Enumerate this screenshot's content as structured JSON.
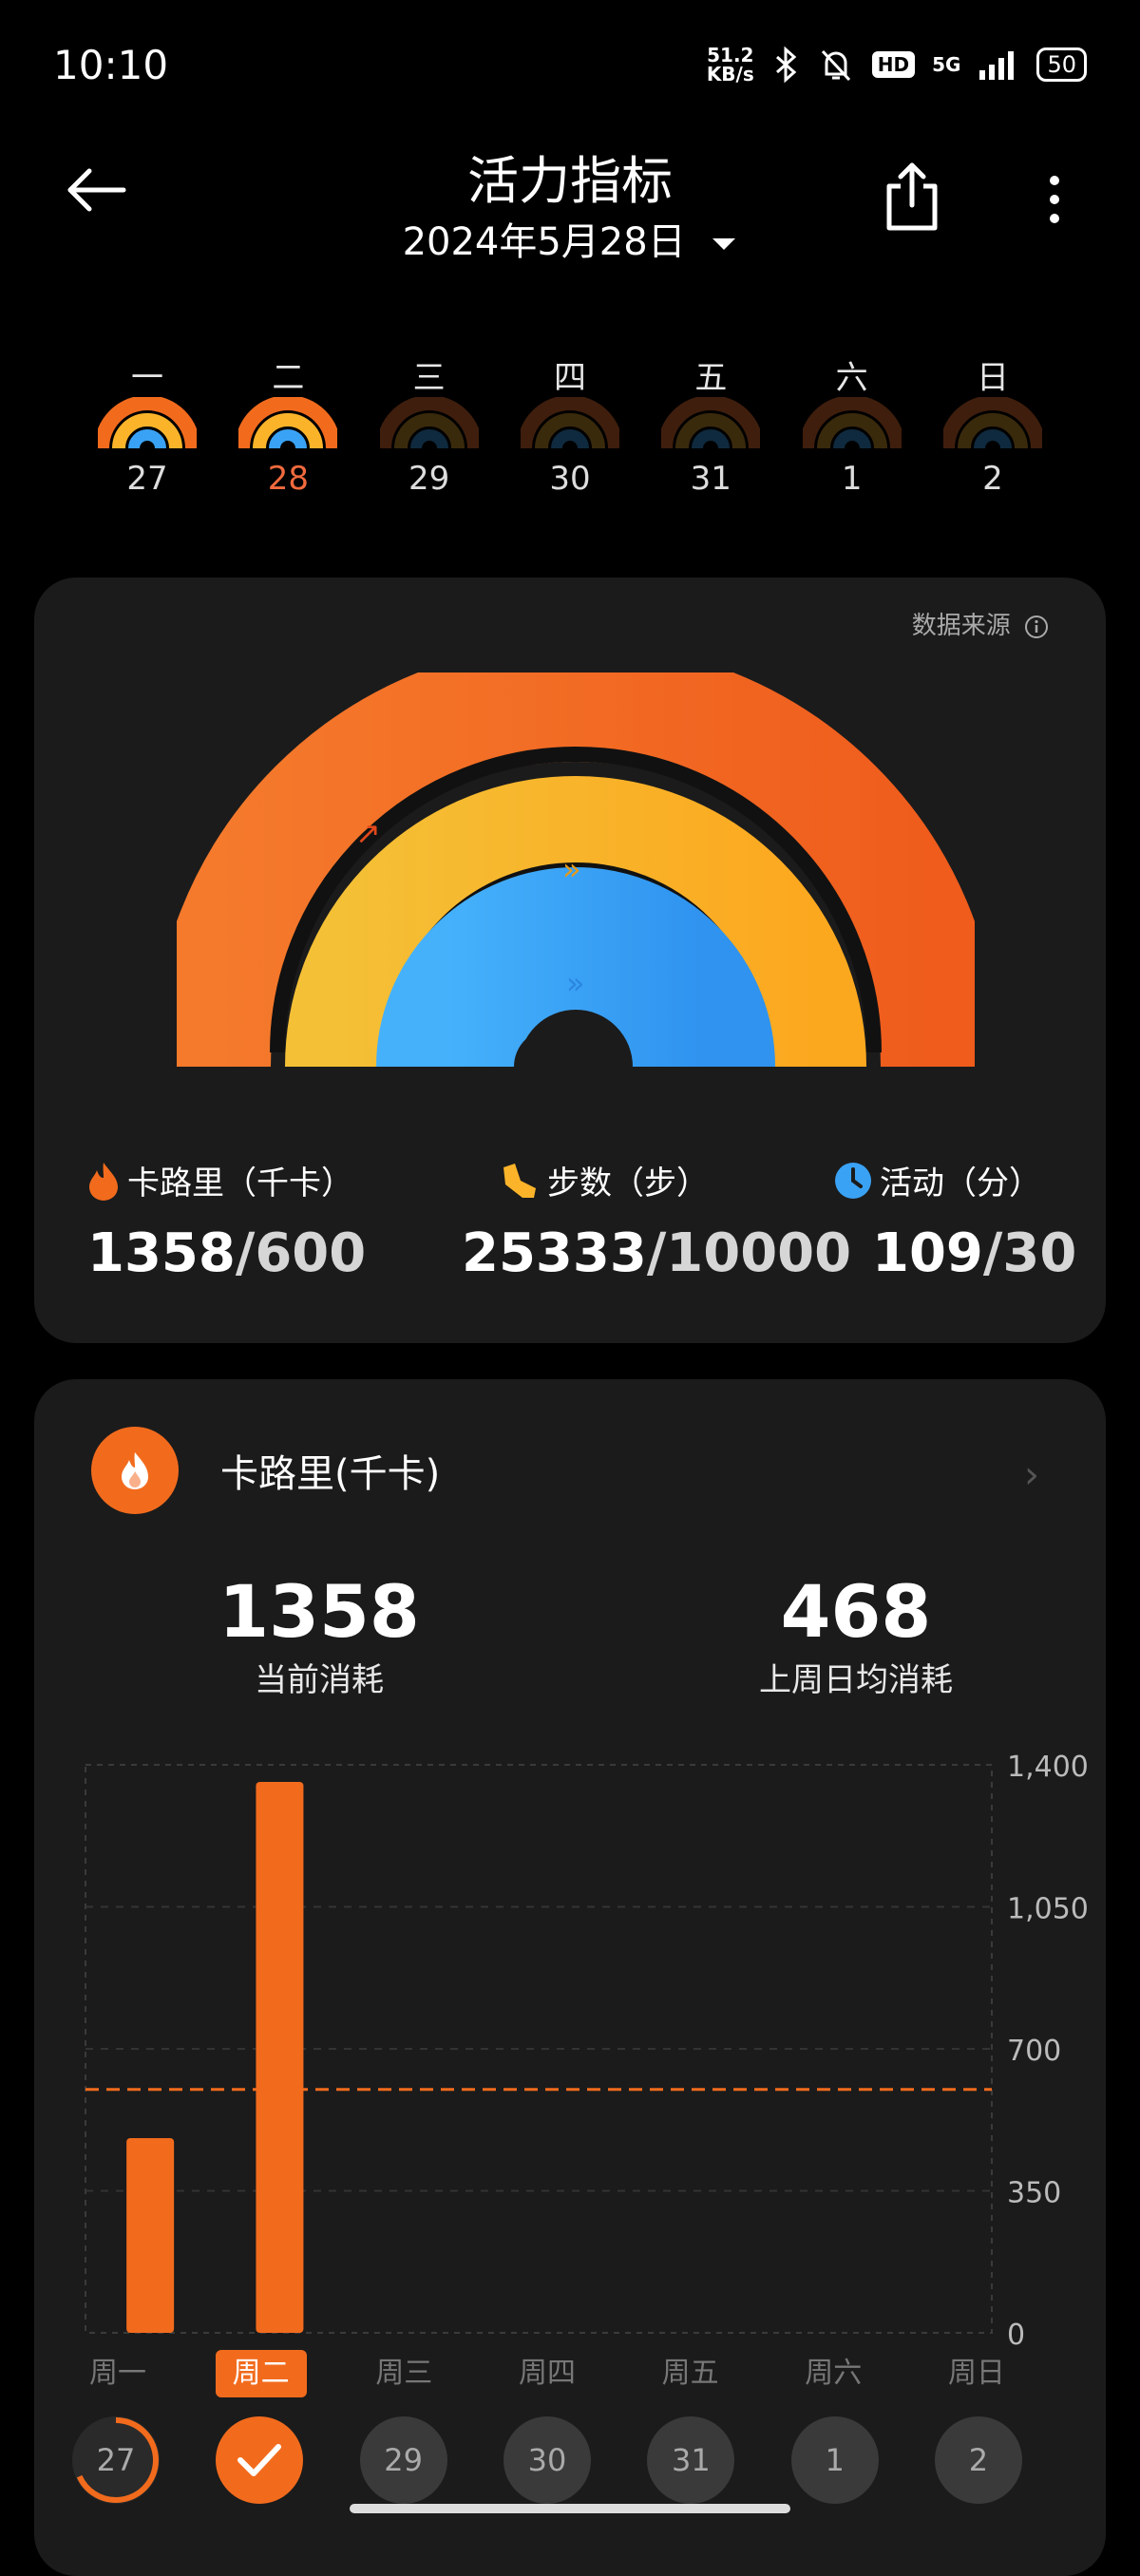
{
  "status": {
    "time": "10:10",
    "net_speed_value": "51.2",
    "net_speed_unit": "KB/s",
    "hd": "HD",
    "network": "5G",
    "battery": "50"
  },
  "header": {
    "title": "活力指标",
    "date": "2024年5月28日"
  },
  "week": {
    "weekdays": [
      "一",
      "二",
      "三",
      "四",
      "五",
      "六",
      "日"
    ],
    "dates": [
      "27",
      "28",
      "29",
      "30",
      "31",
      "1",
      "2"
    ],
    "active_index": 1
  },
  "summary": {
    "data_source": "数据来源",
    "calories": {
      "label": "卡路里（千卡）",
      "value": "1358",
      "goal": "/600",
      "progress": 2.26
    },
    "steps": {
      "label": "步数（步）",
      "value": "25333",
      "goal": "/10000",
      "progress": 2.53
    },
    "activity": {
      "label": "活动（分）",
      "value": "109",
      "goal": "/30",
      "progress": 3.63
    },
    "colors": {
      "calories": "#f26b1d",
      "steps": "#fbb42a",
      "activity": "#3aa2f4"
    }
  },
  "calorie_card": {
    "title": "卡路里(千卡)",
    "current_value": "1358",
    "current_label": "当前消耗",
    "avg_value": "468",
    "avg_label": "上周日均消耗"
  },
  "chart_data": {
    "type": "bar",
    "categories": [
      "周一",
      "周二",
      "周三",
      "周四",
      "周五",
      "周六",
      "周日"
    ],
    "values": [
      480,
      1358,
      0,
      0,
      0,
      0,
      0
    ],
    "ylim": [
      0,
      1400
    ],
    "yticks": [
      "0",
      "350",
      "700",
      "1,050",
      "1,400"
    ],
    "goal_line": 600,
    "bar_color": "#f26b1d",
    "active_index": 1,
    "day_numbers": [
      "27",
      "28",
      "29",
      "30",
      "31",
      "1",
      "2"
    ]
  }
}
